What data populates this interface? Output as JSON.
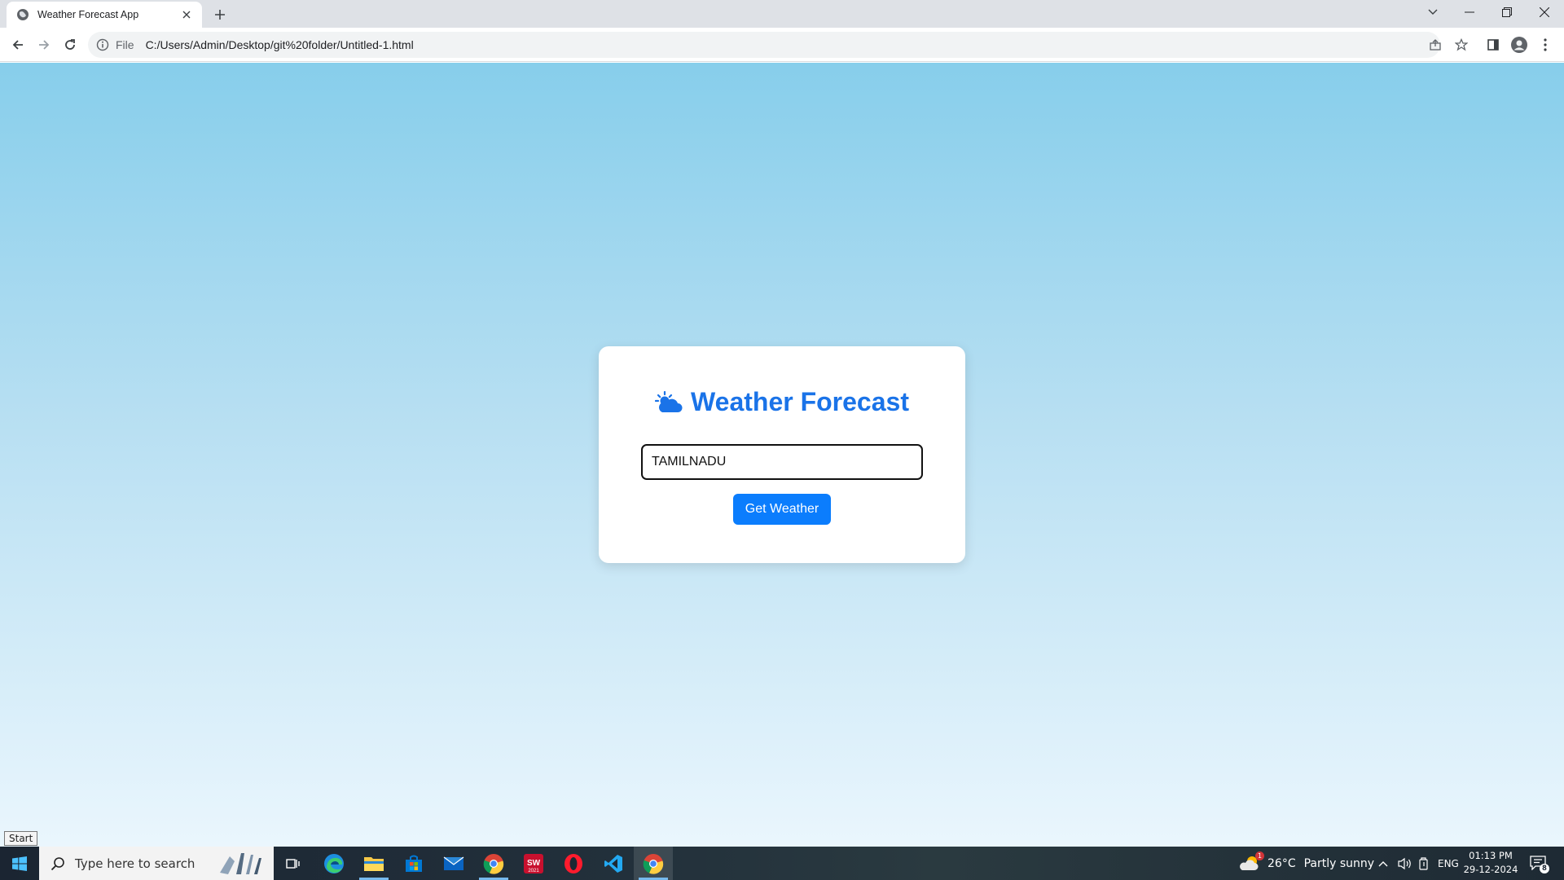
{
  "browser": {
    "tab_title": "Weather Forecast App",
    "address_scheme": "File",
    "address_url": "C:/Users/Admin/Desktop/git%20folder/Untitled-1.html"
  },
  "app": {
    "title": "Weather Forecast",
    "title_icon": "sun-behind-cloud-icon",
    "accent_color": "#1a73e8",
    "city_input_value": "TAMILNADU",
    "button_label": "Get Weather",
    "button_color": "#0b7dfd"
  },
  "tooltip": {
    "start": "Start"
  },
  "taskbar": {
    "search_placeholder": "Type here to search",
    "weather_temp": "26°C",
    "weather_desc": "Partly sunny",
    "weather_badge": "1",
    "language": "ENG",
    "time": "01:13 PM",
    "date": "29-12-2024",
    "notifications_count": "8"
  }
}
